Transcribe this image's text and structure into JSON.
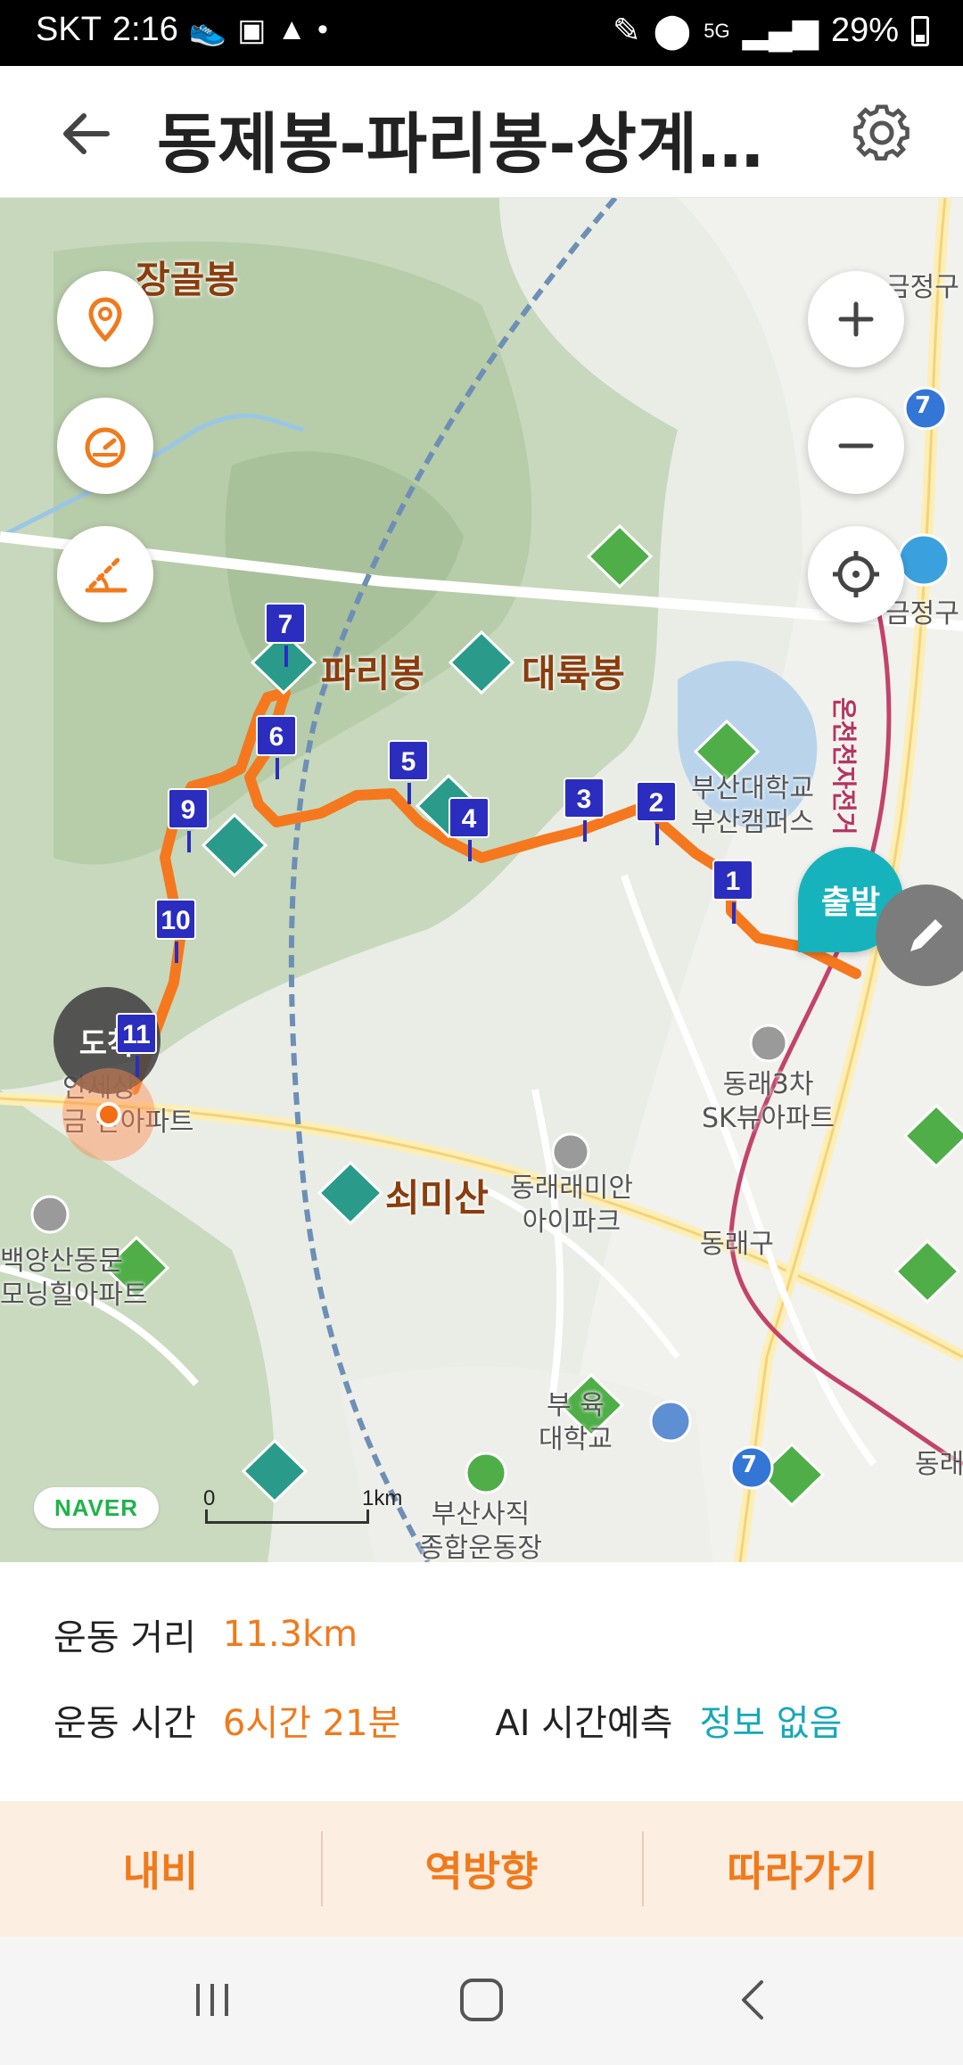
{
  "status_bar": {
    "carrier": "SKT",
    "time": "2:16",
    "network": "5G",
    "battery": "29%"
  },
  "header": {
    "title": "동제봉-파리봉-상계…"
  },
  "map": {
    "labels": {
      "janggolbong": "장골봉",
      "paribong": "파리봉",
      "daeryukbong": "대륙봉",
      "soemisan": "쇠미산",
      "pusan_univ": "부산대학교\n부산캠퍼스",
      "sk_view": "동래3차\nSK뷰아파트",
      "raemian": "동래래미안\n아이파크",
      "dongnae_gu": "동래구",
      "geumjeong_gu": "금정구",
      "geumjeong_top": "금정구",
      "hanjin": "안세상\n금 산아파트",
      "baekyang": "백양산동문\n모닝힐아파트",
      "stadium": "부산사직\n종합운동장",
      "edu_univ": "부 육\n대학교",
      "dongnae_right": "동래",
      "subway_line": "온천천자전거"
    },
    "waypoints": [
      "1",
      "2",
      "3",
      "4",
      "5",
      "6",
      "7",
      "9",
      "10",
      "11"
    ],
    "road_badges": [
      "7",
      "7"
    ],
    "start_label": "출발",
    "arrive_label": "도착",
    "brand": "NAVER",
    "scale_start": "0",
    "scale_end": "1km",
    "colors": {
      "route": "#f5781e",
      "waypoint": "#2b2dbf",
      "start": "#17b3bd",
      "mountain": "#2a9b8a"
    }
  },
  "info": {
    "distance_label": "운동 거리",
    "distance_value": "11.3km",
    "time_label": "운동 시간",
    "time_value": "6시간 21분",
    "ai_label": "AI 시간예측",
    "ai_value": "정보 없음"
  },
  "actions": {
    "navi": "내비",
    "reverse": "역방향",
    "follow": "따라가기"
  }
}
